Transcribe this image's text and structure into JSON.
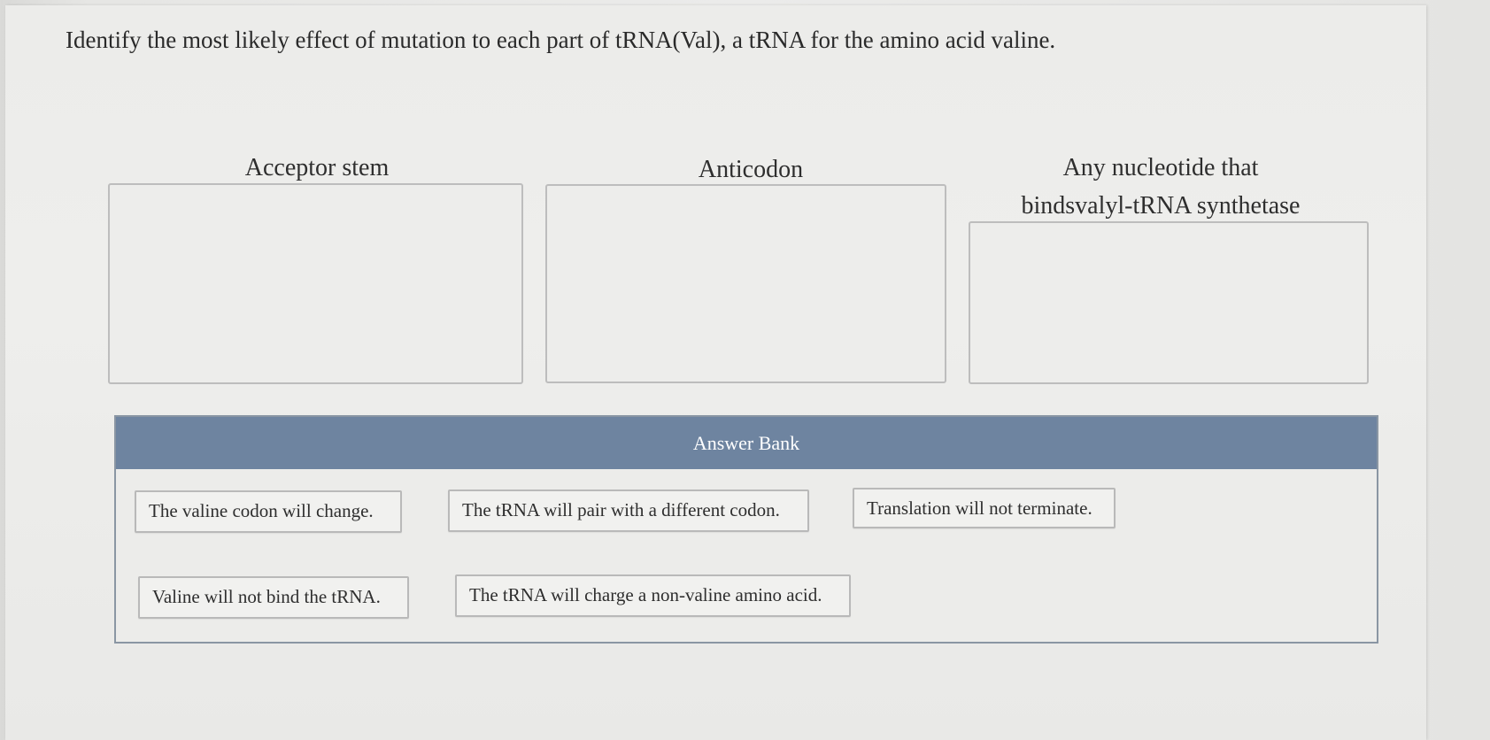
{
  "question": {
    "text": "Identify the most likely effect of mutation to each part of tRNA(Val), a tRNA for the amino acid valine."
  },
  "targets": [
    {
      "label": "Acceptor stem"
    },
    {
      "label": "Anticodon"
    },
    {
      "label_line1": "Any nucleotide that",
      "label_line2": "bindsvalyl-tRNA synthetase"
    }
  ],
  "answer_bank": {
    "title": "Answer Bank",
    "items": [
      "The valine codon will change.",
      "The tRNA will pair with a different codon.",
      "Translation will not terminate.",
      "Valine will not bind the tRNA.",
      "The tRNA will charge a non-valine amino acid."
    ]
  },
  "colors": {
    "header": "#6e84a0",
    "header_text": "#ffffff",
    "border": "#bdbdbd"
  }
}
